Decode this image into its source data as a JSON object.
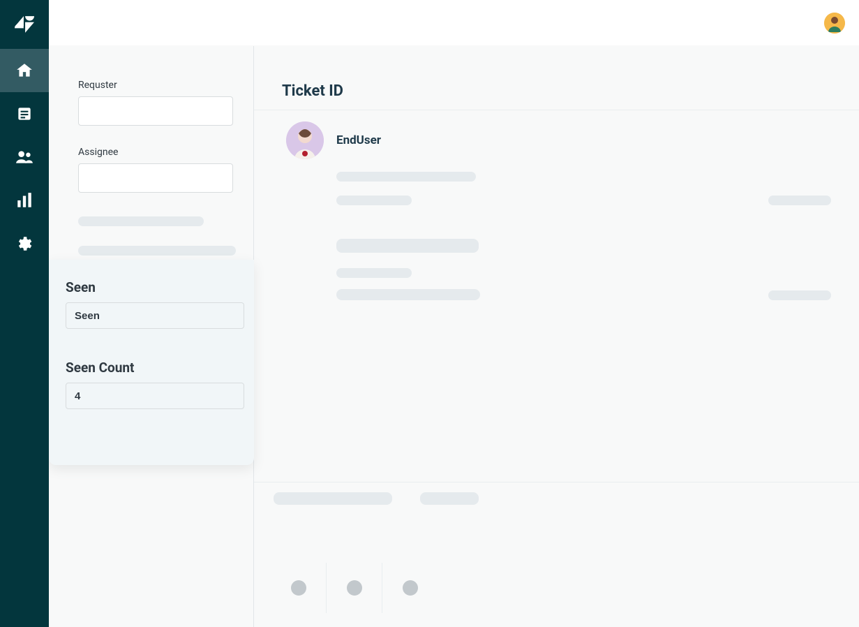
{
  "nav": {
    "logo_aria": "zendesk-logo",
    "items": [
      {
        "name": "home-icon",
        "active": true
      },
      {
        "name": "views-icon",
        "active": false
      },
      {
        "name": "customers-icon",
        "active": false
      },
      {
        "name": "reporting-icon",
        "active": false
      },
      {
        "name": "admin-icon",
        "active": false
      }
    ]
  },
  "header": {
    "agent_avatar_name": "agent-avatar"
  },
  "form": {
    "requester_label": "Requster",
    "requester_value": "",
    "assignee_label": "Assignee",
    "assignee_value": ""
  },
  "app_card": {
    "seen_heading": "Seen",
    "seen_value": "Seen",
    "seen_count_heading": "Seen Count",
    "seen_count_value": "4"
  },
  "ticket": {
    "title": "Ticket  ID",
    "end_user_name": "EndUser"
  },
  "colors": {
    "nav_bg": "#03363D",
    "nav_active": "#335B63",
    "panel_bg": "#F8F9F9",
    "card_bg": "#F1F6F8",
    "skeleton": "#E5EAED",
    "text": "#2F3941",
    "heading": "#1F3A4A"
  }
}
